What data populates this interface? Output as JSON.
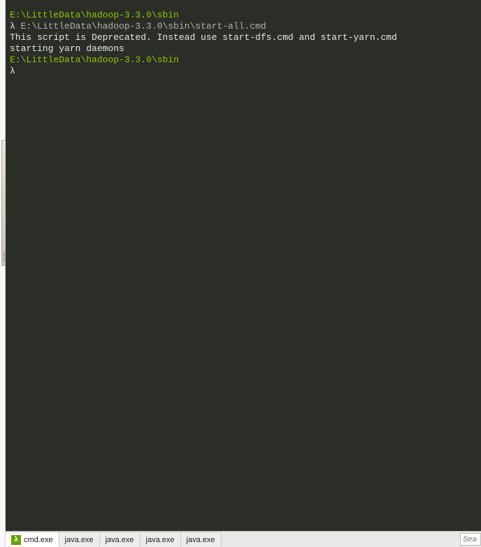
{
  "terminal": {
    "lines": [
      {
        "type": "prompt-path",
        "text": "E:\\LittleData\\hadoop-3.3.0\\sbin"
      },
      {
        "type": "cmd",
        "lambda": "λ ",
        "text": "E:\\LittleData\\hadoop-3.3.0\\sbin\\start-all.cmd"
      },
      {
        "type": "output",
        "text": "This script is Deprecated. Instead use start-dfs.cmd and start-yarn.cmd"
      },
      {
        "type": "output",
        "text": "starting yarn daemons"
      },
      {
        "type": "blank",
        "text": ""
      },
      {
        "type": "prompt-path",
        "text": "E:\\LittleData\\hadoop-3.3.0\\sbin"
      },
      {
        "type": "cmd",
        "lambda": "λ ",
        "text": ""
      }
    ]
  },
  "tabs": [
    {
      "label": "cmd.exe",
      "active": true,
      "icon": "lambda",
      "icon_char": "λ"
    },
    {
      "label": "java.exe",
      "active": false
    },
    {
      "label": "java.exe",
      "active": false
    },
    {
      "label": "java.exe",
      "active": false
    },
    {
      "label": "java.exe",
      "active": false
    }
  ],
  "search": {
    "placeholder": "Sea"
  }
}
